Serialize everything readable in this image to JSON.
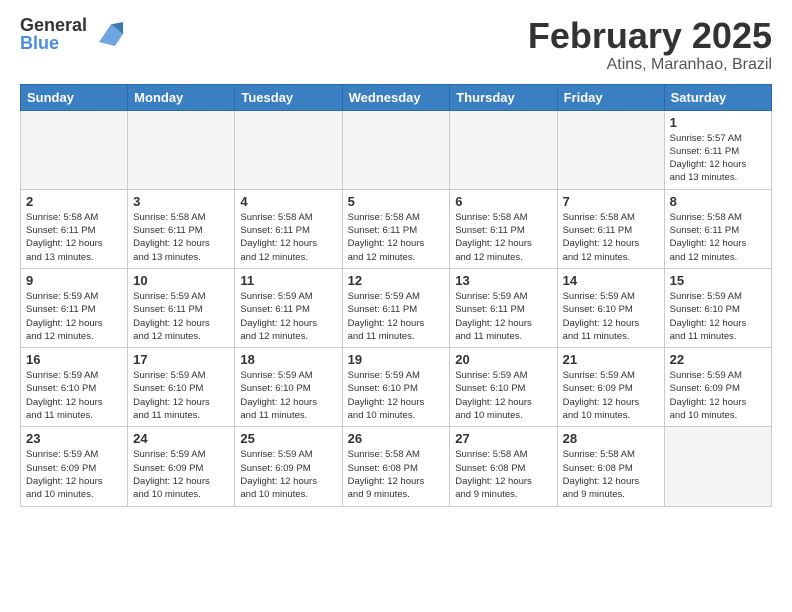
{
  "header": {
    "logo_general": "General",
    "logo_blue": "Blue",
    "month_title": "February 2025",
    "location": "Atins, Maranhao, Brazil"
  },
  "days_of_week": [
    "Sunday",
    "Monday",
    "Tuesday",
    "Wednesday",
    "Thursday",
    "Friday",
    "Saturday"
  ],
  "weeks": [
    [
      {
        "day": "",
        "info": ""
      },
      {
        "day": "",
        "info": ""
      },
      {
        "day": "",
        "info": ""
      },
      {
        "day": "",
        "info": ""
      },
      {
        "day": "",
        "info": ""
      },
      {
        "day": "",
        "info": ""
      },
      {
        "day": "1",
        "info": "Sunrise: 5:57 AM\nSunset: 6:11 PM\nDaylight: 12 hours\nand 13 minutes."
      }
    ],
    [
      {
        "day": "2",
        "info": "Sunrise: 5:58 AM\nSunset: 6:11 PM\nDaylight: 12 hours\nand 13 minutes."
      },
      {
        "day": "3",
        "info": "Sunrise: 5:58 AM\nSunset: 6:11 PM\nDaylight: 12 hours\nand 13 minutes."
      },
      {
        "day": "4",
        "info": "Sunrise: 5:58 AM\nSunset: 6:11 PM\nDaylight: 12 hours\nand 12 minutes."
      },
      {
        "day": "5",
        "info": "Sunrise: 5:58 AM\nSunset: 6:11 PM\nDaylight: 12 hours\nand 12 minutes."
      },
      {
        "day": "6",
        "info": "Sunrise: 5:58 AM\nSunset: 6:11 PM\nDaylight: 12 hours\nand 12 minutes."
      },
      {
        "day": "7",
        "info": "Sunrise: 5:58 AM\nSunset: 6:11 PM\nDaylight: 12 hours\nand 12 minutes."
      },
      {
        "day": "8",
        "info": "Sunrise: 5:58 AM\nSunset: 6:11 PM\nDaylight: 12 hours\nand 12 minutes."
      }
    ],
    [
      {
        "day": "9",
        "info": "Sunrise: 5:59 AM\nSunset: 6:11 PM\nDaylight: 12 hours\nand 12 minutes."
      },
      {
        "day": "10",
        "info": "Sunrise: 5:59 AM\nSunset: 6:11 PM\nDaylight: 12 hours\nand 12 minutes."
      },
      {
        "day": "11",
        "info": "Sunrise: 5:59 AM\nSunset: 6:11 PM\nDaylight: 12 hours\nand 12 minutes."
      },
      {
        "day": "12",
        "info": "Sunrise: 5:59 AM\nSunset: 6:11 PM\nDaylight: 12 hours\nand 11 minutes."
      },
      {
        "day": "13",
        "info": "Sunrise: 5:59 AM\nSunset: 6:11 PM\nDaylight: 12 hours\nand 11 minutes."
      },
      {
        "day": "14",
        "info": "Sunrise: 5:59 AM\nSunset: 6:10 PM\nDaylight: 12 hours\nand 11 minutes."
      },
      {
        "day": "15",
        "info": "Sunrise: 5:59 AM\nSunset: 6:10 PM\nDaylight: 12 hours\nand 11 minutes."
      }
    ],
    [
      {
        "day": "16",
        "info": "Sunrise: 5:59 AM\nSunset: 6:10 PM\nDaylight: 12 hours\nand 11 minutes."
      },
      {
        "day": "17",
        "info": "Sunrise: 5:59 AM\nSunset: 6:10 PM\nDaylight: 12 hours\nand 11 minutes."
      },
      {
        "day": "18",
        "info": "Sunrise: 5:59 AM\nSunset: 6:10 PM\nDaylight: 12 hours\nand 11 minutes."
      },
      {
        "day": "19",
        "info": "Sunrise: 5:59 AM\nSunset: 6:10 PM\nDaylight: 12 hours\nand 10 minutes."
      },
      {
        "day": "20",
        "info": "Sunrise: 5:59 AM\nSunset: 6:10 PM\nDaylight: 12 hours\nand 10 minutes."
      },
      {
        "day": "21",
        "info": "Sunrise: 5:59 AM\nSunset: 6:09 PM\nDaylight: 12 hours\nand 10 minutes."
      },
      {
        "day": "22",
        "info": "Sunrise: 5:59 AM\nSunset: 6:09 PM\nDaylight: 12 hours\nand 10 minutes."
      }
    ],
    [
      {
        "day": "23",
        "info": "Sunrise: 5:59 AM\nSunset: 6:09 PM\nDaylight: 12 hours\nand 10 minutes."
      },
      {
        "day": "24",
        "info": "Sunrise: 5:59 AM\nSunset: 6:09 PM\nDaylight: 12 hours\nand 10 minutes."
      },
      {
        "day": "25",
        "info": "Sunrise: 5:59 AM\nSunset: 6:09 PM\nDaylight: 12 hours\nand 10 minutes."
      },
      {
        "day": "26",
        "info": "Sunrise: 5:58 AM\nSunset: 6:08 PM\nDaylight: 12 hours\nand 9 minutes."
      },
      {
        "day": "27",
        "info": "Sunrise: 5:58 AM\nSunset: 6:08 PM\nDaylight: 12 hours\nand 9 minutes."
      },
      {
        "day": "28",
        "info": "Sunrise: 5:58 AM\nSunset: 6:08 PM\nDaylight: 12 hours\nand 9 minutes."
      },
      {
        "day": "",
        "info": ""
      }
    ]
  ]
}
